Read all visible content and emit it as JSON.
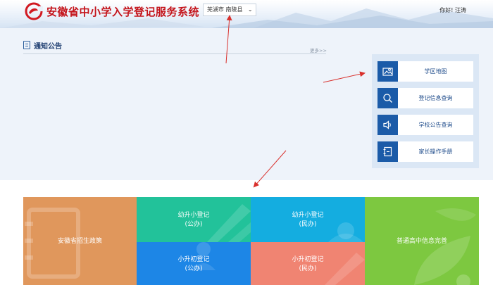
{
  "header": {
    "title": "安徽省中小学入学登记服务系统",
    "region": "芜湖市 南陵县",
    "greeting": "你好! 汪涛"
  },
  "notice": {
    "title": "通知公告",
    "more": "更多>>"
  },
  "quick_links": [
    {
      "label": "学区地图",
      "icon": "map-icon"
    },
    {
      "label": "登记信息查询",
      "icon": "search-icon"
    },
    {
      "label": "学校公告查询",
      "icon": "speaker-icon"
    },
    {
      "label": "家长操作手册",
      "icon": "manual-icon"
    }
  ],
  "tiles": {
    "policy": {
      "label": "安徽省招生政策",
      "color": "#e0975c"
    },
    "k_to_p_public": {
      "line1": "幼升小登记",
      "line2": "(公办)",
      "color": "#22c29a"
    },
    "k_to_p_private": {
      "line1": "幼升小登记",
      "line2": "(民办)",
      "color": "#14ade0"
    },
    "p_to_m_public": {
      "line1": "小升初登记",
      "line2": "(公办)",
      "color": "#1d86e6"
    },
    "p_to_m_private": {
      "line1": "小升初登记",
      "line2": "(民办)",
      "color": "#f08472"
    },
    "high_school": {
      "label": "普通高中信息完善",
      "color": "#7dc840"
    }
  },
  "colors": {
    "brand_red": "#c4141b",
    "accent_blue": "#1b5ba8",
    "annotation_red": "#d9302c"
  }
}
